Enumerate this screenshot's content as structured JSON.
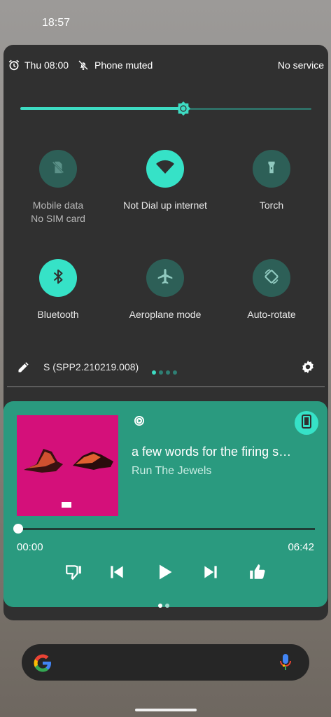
{
  "status_bar": {
    "time": "18:57"
  },
  "qs_header": {
    "alarm_time": "Thu 08:00",
    "mute_status": "Phone muted",
    "service_status": "No service"
  },
  "brightness": {
    "level": 0.56
  },
  "tiles": [
    {
      "label": "Mobile data",
      "sublabel": "No SIM card",
      "active": false,
      "icon": "no-sim-icon"
    },
    {
      "label": "Not Dial up internet",
      "sublabel": "",
      "active": true,
      "icon": "wifi-icon"
    },
    {
      "label": "Torch",
      "sublabel": "",
      "active": false,
      "icon": "flashlight-icon"
    },
    {
      "label": "Bluetooth",
      "sublabel": "",
      "active": true,
      "icon": "bluetooth-icon"
    },
    {
      "label": "Aeroplane mode",
      "sublabel": "",
      "active": false,
      "icon": "airplane-icon"
    },
    {
      "label": "Auto-rotate",
      "sublabel": "",
      "active": false,
      "icon": "auto-rotate-icon"
    }
  ],
  "footer": {
    "build": "S (SPP2.210219.008)"
  },
  "media": {
    "title": "a few words for the firing s…",
    "artist": "Run The Jewels",
    "elapsed": "00:00",
    "duration": "06:42",
    "progress": 0.0
  },
  "colors": {
    "accent": "#36e2c7",
    "panel": "#303030",
    "media_bg": "#2a9a7f",
    "album_art": "#d4107a"
  }
}
